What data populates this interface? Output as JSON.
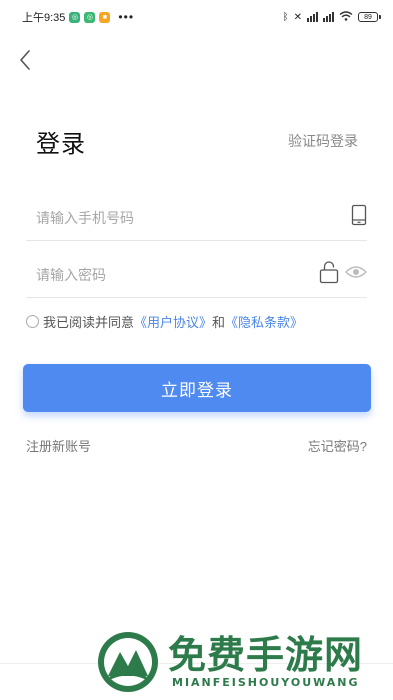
{
  "status": {
    "time": "上午9:35",
    "dots": "•••",
    "battery": "89"
  },
  "icons": {
    "back": "chevron-left-icon",
    "phone": "phone-icon",
    "lock": "lock-icon",
    "eye": "eye-icon"
  },
  "colors": {
    "accent": "#4f8af0",
    "link": "#4a86e8",
    "watermark": "#2d7a4a"
  },
  "header": {
    "title": "登录",
    "switch_label": "验证码登录"
  },
  "form": {
    "phone_placeholder": "请输入手机号码",
    "password_placeholder": "请输入密码"
  },
  "agreement": {
    "prefix": "我已阅读并同意",
    "user_agreement": "《用户协议》",
    "and": "和",
    "privacy": "《隐私条款》"
  },
  "actions": {
    "login_label": "立即登录",
    "register_label": "注册新账号",
    "forgot_label": "忘记密码?"
  },
  "watermark": {
    "title": "免费手游网",
    "subtitle": "MIANFEISHOUYOUWANG"
  }
}
